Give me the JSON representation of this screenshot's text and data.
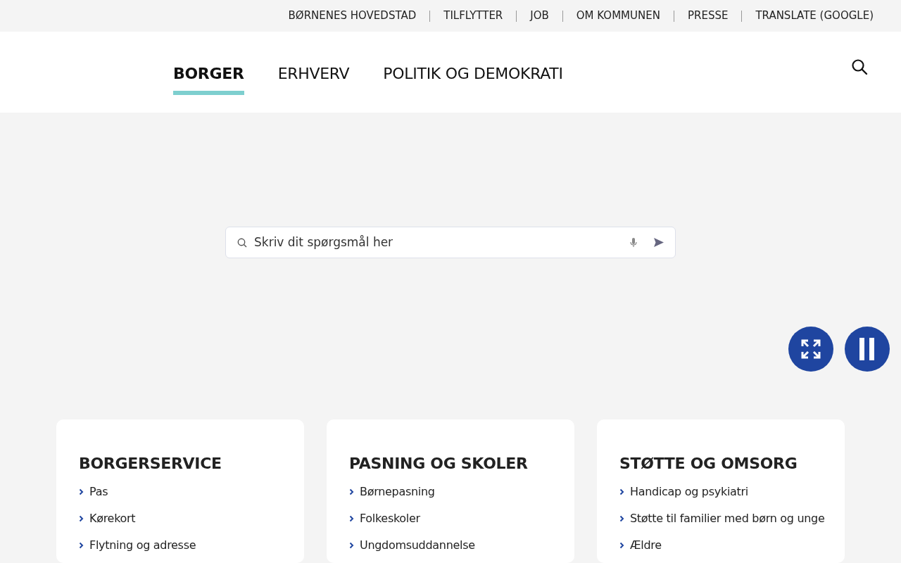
{
  "top_links": [
    {
      "label": "BØRNENES HOVEDSTAD"
    },
    {
      "label": "TILFLYTTER"
    },
    {
      "label": "JOB"
    },
    {
      "label": "OM KOMMUNEN"
    },
    {
      "label": "PRESSE"
    },
    {
      "label": "TRANSLATE (GOOGLE)"
    }
  ],
  "main_nav": [
    {
      "label": "BORGER",
      "selected": true
    },
    {
      "label": "ERHVERV",
      "selected": false
    },
    {
      "label": "POLITIK OG DEMOKRATI",
      "selected": false
    }
  ],
  "hero": {
    "search": {
      "placeholder": "Skriv dit spørgsmål her"
    }
  },
  "cards": [
    {
      "title": "BORGERSERVICE",
      "links": [
        "Pas",
        "Kørekort",
        "Flytning og adresse"
      ]
    },
    {
      "title": "PASNING OG SKOLER",
      "links": [
        "Børnepasning",
        "Folkeskoler",
        "Ungdomsuddannelse"
      ]
    },
    {
      "title": "STØTTE OG OMSORG",
      "links": [
        "Handicap og psykiatri",
        "Støtte til familier med børn og unge",
        "Ældre"
      ]
    }
  ]
}
